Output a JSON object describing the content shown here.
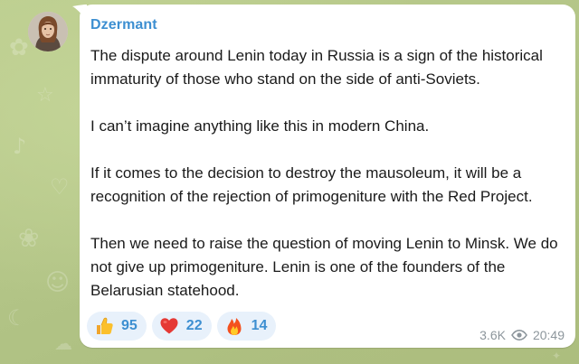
{
  "message": {
    "sender": "Dzermant",
    "paragraphs": [
      "The dispute around Lenin today in Russia is a sign of the historical immaturity of those who stand on the side of anti-Soviets.",
      "I can’t imagine anything like this in modern China.",
      "If it comes to the decision to destroy the mausoleum, it will be a recognition of the rejection of primogeniture with the Red Project.",
      "Then we need to raise the question of moving Lenin to Minsk. We do not give up primogeniture. Lenin is one of the founders of the Belarusian statehood."
    ],
    "reactions": [
      {
        "icon": "thumbs-up-icon",
        "count": "95"
      },
      {
        "icon": "red-heart-icon",
        "count": "22"
      },
      {
        "icon": "fire-icon",
        "count": "14"
      }
    ],
    "views": "3.6K",
    "time": "20:49"
  },
  "colors": {
    "sender": "#3d8fd1",
    "reaction_bg": "#e8f1fb",
    "meta": "#8d969c",
    "chat_bg": "#b8c98a"
  }
}
